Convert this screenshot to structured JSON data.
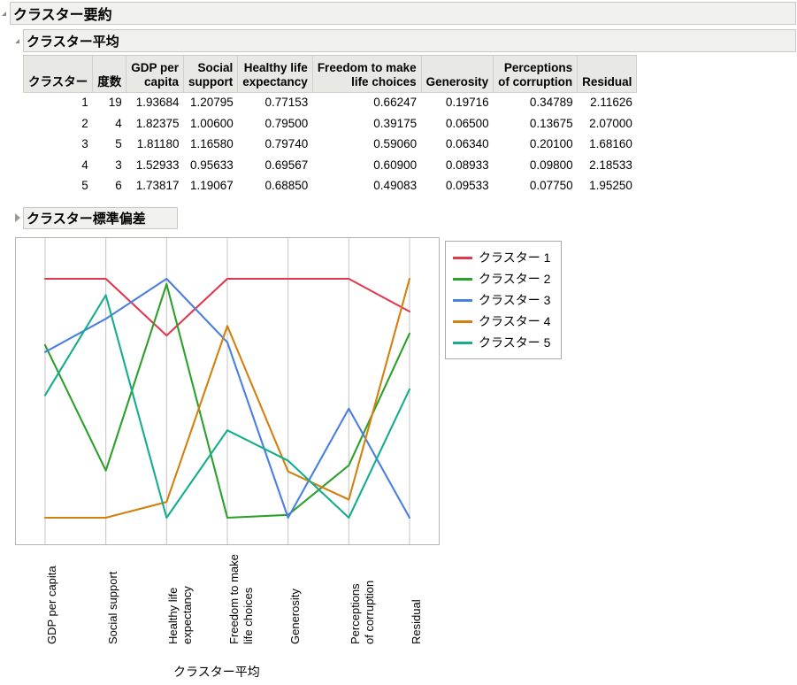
{
  "outline": {
    "summary": {
      "title": "クラスター要約",
      "state": "expanded",
      "icon": "triangle-down-icon"
    },
    "means": {
      "title": "クラスター平均",
      "state": "expanded",
      "icon": "triangle-down-icon"
    },
    "std_dev": {
      "title": "クラスター標準偏差",
      "state": "collapsed",
      "icon": "triangle-right-icon"
    }
  },
  "table": {
    "columns": [
      "クラスター",
      "度数",
      "GDP per\ncapita",
      "Social\nsupport",
      "Healthy life\nexpectancy",
      "Freedom to make\nlife choices",
      "Generosity",
      "Perceptions\nof corruption",
      "Residual"
    ],
    "rows": [
      [
        "1",
        "19",
        "1.93684",
        "1.20795",
        "0.77153",
        "0.66247",
        "0.19716",
        "0.34789",
        "2.11626"
      ],
      [
        "2",
        "4",
        "1.82375",
        "1.00600",
        "0.79500",
        "0.39175",
        "0.06500",
        "0.13675",
        "2.07000"
      ],
      [
        "3",
        "5",
        "1.81180",
        "1.16580",
        "0.79740",
        "0.59060",
        "0.06340",
        "0.20100",
        "1.68160"
      ],
      [
        "4",
        "3",
        "1.52933",
        "0.95633",
        "0.69567",
        "0.60900",
        "0.08933",
        "0.09800",
        "2.18533"
      ],
      [
        "5",
        "6",
        "1.73817",
        "1.19067",
        "0.68850",
        "0.49083",
        "0.09533",
        "0.07750",
        "1.95250"
      ]
    ]
  },
  "chart_data": {
    "type": "line",
    "title": "",
    "xlabel": "クラスター平均",
    "ylabel": "",
    "grid": true,
    "legend_position": "right",
    "categories": [
      "GDP per capita",
      "Social support",
      "Healthy life\nexpectancy",
      "Freedom to make\nlife choices",
      "Generosity",
      "Perceptions\nof corruption",
      "Residual"
    ],
    "normalized": true,
    "note": "parallel-coordinates: each axis scaled independently to its own min/max",
    "axis_ranges": [
      [
        1.52933,
        1.93684
      ],
      [
        0.95633,
        1.20795
      ],
      [
        0.6885,
        0.7974
      ],
      [
        0.39175,
        0.66247
      ],
      [
        0.0634,
        0.19716
      ],
      [
        0.0775,
        0.34789
      ],
      [
        1.6816,
        2.18533
      ]
    ],
    "series": [
      {
        "name": "クラスター 1",
        "color": "#e0384f",
        "values": [
          1.93684,
          1.20795,
          0.77153,
          0.66247,
          0.19716,
          0.34789,
          2.11626
        ]
      },
      {
        "name": "クラスター 2",
        "color": "#2ca02c",
        "values": [
          1.82375,
          1.006,
          0.795,
          0.39175,
          0.065,
          0.13675,
          2.07
        ]
      },
      {
        "name": "クラスター 3",
        "color": "#4a7fe0",
        "values": [
          1.8118,
          1.1658,
          0.7974,
          0.5906,
          0.0634,
          0.201,
          1.6816
        ]
      },
      {
        "name": "クラスター 4",
        "color": "#d2800f",
        "values": [
          1.52933,
          0.95633,
          0.69567,
          0.609,
          0.08933,
          0.098,
          2.18533
        ]
      },
      {
        "name": "クラスター 5",
        "color": "#15ad8e",
        "values": [
          1.73817,
          1.19067,
          0.6885,
          0.49083,
          0.09533,
          0.0775,
          1.9525
        ]
      }
    ]
  },
  "colors": {
    "cluster1": "#e0384f",
    "cluster2": "#2ca02c",
    "cluster3": "#4a7fe0",
    "cluster4": "#d2800f",
    "cluster5": "#15ad8e",
    "panel_bg": "#f0f0ee",
    "header_bg": "#e8e8e4",
    "gridline": "#c4c4c4"
  }
}
